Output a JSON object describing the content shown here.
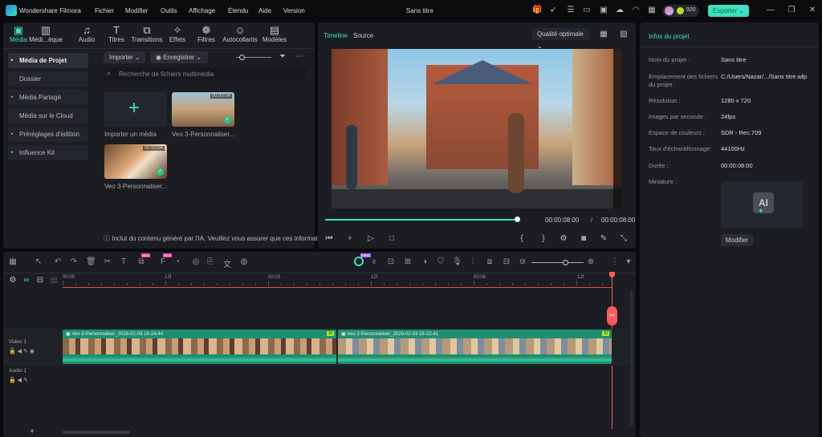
{
  "app": {
    "name": "Wondershare Filmora",
    "title": "Sans titre",
    "credits": "920",
    "export_label": "Exporter",
    "accent": "#3de0c0"
  },
  "menu": [
    "Fichier",
    "Modifier",
    "Outils",
    "Affichage",
    "Étendu",
    "Aide",
    "Version"
  ],
  "tabs": [
    {
      "label": "Média",
      "icon": "media-icon",
      "active": true
    },
    {
      "label": "Médi...èque",
      "icon": "library-icon"
    },
    {
      "label": "Audio",
      "icon": "music-icon"
    },
    {
      "label": "Titres",
      "icon": "text-icon"
    },
    {
      "label": "Transitions",
      "icon": "transition-icon"
    },
    {
      "label": "Effets",
      "icon": "effects-icon"
    },
    {
      "label": "Filtres",
      "icon": "filter-icon"
    },
    {
      "label": "Autocollants",
      "icon": "sticker-icon"
    },
    {
      "label": "Modèles",
      "icon": "template-icon"
    }
  ],
  "sidebar": [
    "Média de Projet",
    "Dossier",
    "Média Partagé",
    "Média sur le Cloud",
    "Préréglages d'édition",
    "Influence Kit"
  ],
  "media": {
    "import_btn": "Importer",
    "record_btn": "Enregistrer",
    "search_placeholder": "Recherche de fichiers multimédia",
    "import_tile": "Importer un média",
    "items": [
      {
        "name": "Veo 3-Personnaliser...",
        "duration": "00:00:04"
      },
      {
        "name": "Veo 3-Personnaliser...",
        "duration": "00:00:04"
      }
    ],
    "ai_notice": "Inclut du contenu généré par l'IA. Veuillez vous assurer que ces informati.."
  },
  "preview": {
    "tab_timeline": "Timeline",
    "tab_source": "Source",
    "quality": "Qualité optimale",
    "current_time": "00:00:08:00",
    "separator": "/",
    "total_time": "00:00:08:00",
    "progress": 1.0
  },
  "project_info": {
    "title": "Infos du projet",
    "rows": [
      {
        "k": "Nom du projet :",
        "v": "Sans titre"
      },
      {
        "k": "Emplacement des fichiers du projet :",
        "v": "C:/Users/Nazar/.../Sans titre.wfp"
      },
      {
        "k": "Résolution :",
        "v": "1280 x 720"
      },
      {
        "k": "Images par seconde :",
        "v": "24fps"
      },
      {
        "k": "Espace de couleurs :",
        "v": "SDR - Rec.709"
      },
      {
        "k": "Taux d'échantillonnage:",
        "v": "44100Hz"
      },
      {
        "k": "Durée :",
        "v": "00:00:08:00"
      },
      {
        "k": "Miniature :",
        "v": ""
      }
    ],
    "modify_btn": "Modifier"
  },
  "timeline": {
    "ruler": [
      "00:00",
      "12f",
      "00:03",
      "12f",
      "00:06",
      "12f"
    ],
    "tracks": [
      {
        "name": "Vidéo 1"
      },
      {
        "name": "Audio 1"
      }
    ],
    "clips": [
      {
        "name": "Veo 3-Personnaliser_2026-02-03 19-14-44",
        "badge": "AI"
      },
      {
        "name": "Veo 3-Personnaliser_2026-02-03 19-22-41",
        "badge": "AI"
      }
    ],
    "badge_new": "NEW"
  }
}
